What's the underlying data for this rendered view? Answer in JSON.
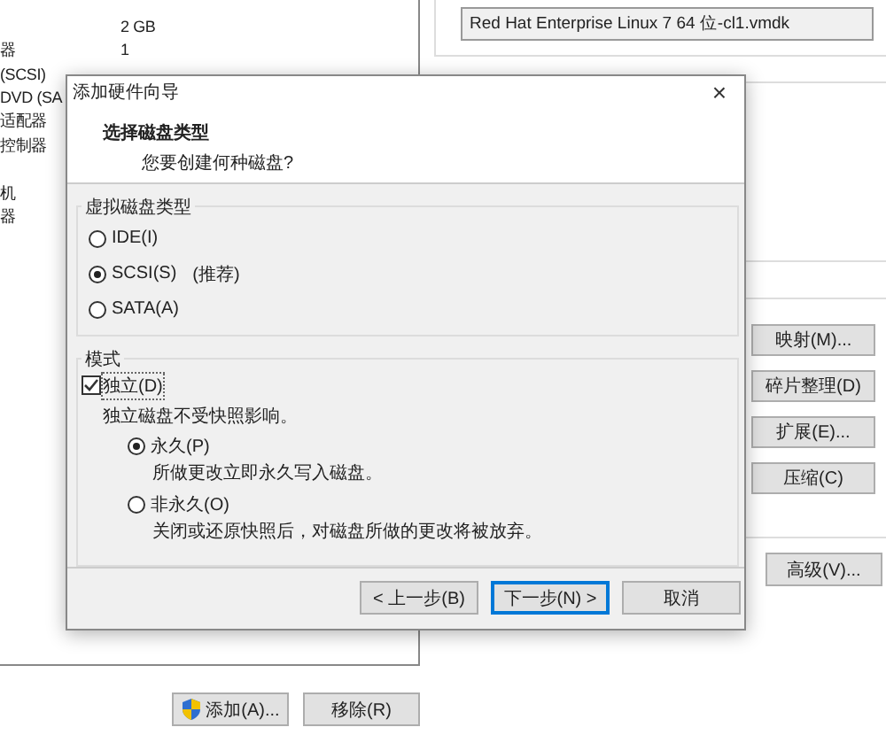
{
  "device_list": {
    "rows": [
      {
        "summary": "2 GB"
      },
      {
        "device": "器",
        "summary": "1"
      },
      {
        "device": "(SCSI)"
      },
      {
        "device": "DVD (SA"
      },
      {
        "device": "适配器"
      },
      {
        "device": "控制器"
      },
      {},
      {
        "device": "机"
      },
      {
        "device": "器"
      }
    ],
    "buttons": [
      {
        "label": "添加(A)...",
        "kind": "shield"
      },
      {
        "label": "移除(R)",
        "kind": "plain"
      }
    ]
  },
  "disk_file": {
    "value": "Red Hat Enterprise Linux 7 64 位-cl1.vmdk"
  },
  "utility_buttons": [
    "映射(M)...",
    "碎片整理(D)",
    "扩展(E)...",
    "压缩(C)"
  ],
  "advanced_button": "高级(V)...",
  "dialog": {
    "title": "添加硬件向导",
    "close": "×",
    "heading": "选择磁盘类型",
    "subheading": "您要创建何种磁盘?",
    "disk_type": {
      "legend": "虚拟磁盘类型",
      "options": [
        {
          "label": "IDE(I)",
          "selected": false
        },
        {
          "label": "SCSI(S)",
          "note": "(推荐)",
          "selected": true
        },
        {
          "label": "SATA(A)",
          "selected": false
        }
      ]
    },
    "mode": {
      "legend": "模式",
      "independent": {
        "label": "独立(D)",
        "checked": true
      },
      "description": "独立磁盘不受快照影响。",
      "options": [
        {
          "label": "永久(P)",
          "description": "所做更改立即永久写入磁盘。",
          "selected": true
        },
        {
          "label": "非永久(O)",
          "description": "关闭或还原快照后，对磁盘所做的更改将被放弃。",
          "selected": false
        }
      ]
    },
    "buttons": [
      {
        "label": "< 上一步(B)",
        "default": false
      },
      {
        "label": "下一步(N) >",
        "default": true
      },
      {
        "label": "取消",
        "default": false
      }
    ]
  }
}
